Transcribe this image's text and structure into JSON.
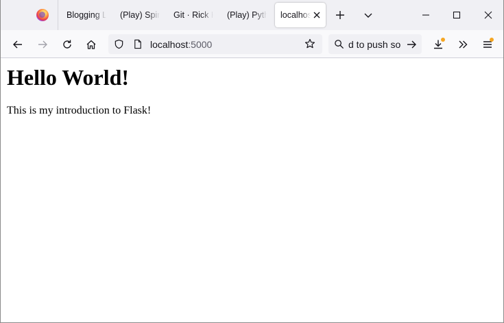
{
  "tabs": [
    {
      "title": "Blogging L",
      "active": false
    },
    {
      "title": "(Play) Spir",
      "active": false
    },
    {
      "title": "Git · Rick K",
      "active": false
    },
    {
      "title": "(Play) Pyth",
      "active": false
    },
    {
      "title": "localhost",
      "active": true
    }
  ],
  "toolbar": {
    "url_host": "localhost",
    "url_port": ":5000",
    "search_value": "d to push so"
  },
  "page": {
    "heading": "Hello World!",
    "paragraph": "This is my introduction to Flask!"
  },
  "icons": {
    "firefox": "firefox-icon",
    "new_tab": "plus-icon",
    "list_all_tabs": "chevron-down-icon",
    "back": "arrow-left-icon",
    "forward": "arrow-right-icon",
    "reload": "reload-icon",
    "home": "home-icon",
    "tracking_protection": "shield-icon",
    "page_info": "page-icon",
    "bookmark": "star-icon",
    "search": "search-icon",
    "search_go": "arrow-right-icon",
    "downloads": "download-icon",
    "overflow": "double-chevron-icon",
    "menu": "hamburger-icon"
  },
  "colors": {
    "tabstrip_bg": "#f0f0f4",
    "toolbar_bg": "#f9f9fb",
    "field_bg": "#f0f0f4",
    "attention_badge": "#f5a623"
  }
}
